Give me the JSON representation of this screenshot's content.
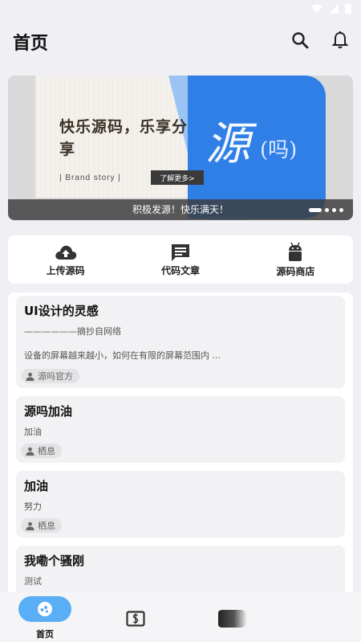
{
  "status": {
    "time": "2:03"
  },
  "header": {
    "title": "首页"
  },
  "banner": {
    "headline": "快乐源码，乐享分享",
    "brand": "| Brand story |",
    "more_button": "了解更多>",
    "glyph_large": "源",
    "glyph_small": "(吗)",
    "caption": "积极发源！快乐满天！"
  },
  "quick_actions": [
    {
      "label": "上传源码",
      "icon": "cloud-upload-icon"
    },
    {
      "label": "代码文章",
      "icon": "chat-icon"
    },
    {
      "label": "源码商店",
      "icon": "android-icon"
    }
  ],
  "posts": [
    {
      "title": "UI设计的灵感",
      "subtitle": "——————摘抄自网络",
      "description": "设备的屏幕越来越小，如何在有限的屏幕范围内 ...",
      "author": "源吗官方"
    },
    {
      "title": "源吗加油",
      "subtitle": "加油",
      "author": "栖息"
    },
    {
      "title": "加油",
      "subtitle": "努力",
      "author": "栖息"
    },
    {
      "title": "我嘞个骚刚",
      "subtitle": "测试"
    }
  ],
  "nav": {
    "home_label": "首页"
  },
  "colors": {
    "accent": "#5aaef5",
    "banner_blue": "#2f7fe6"
  }
}
